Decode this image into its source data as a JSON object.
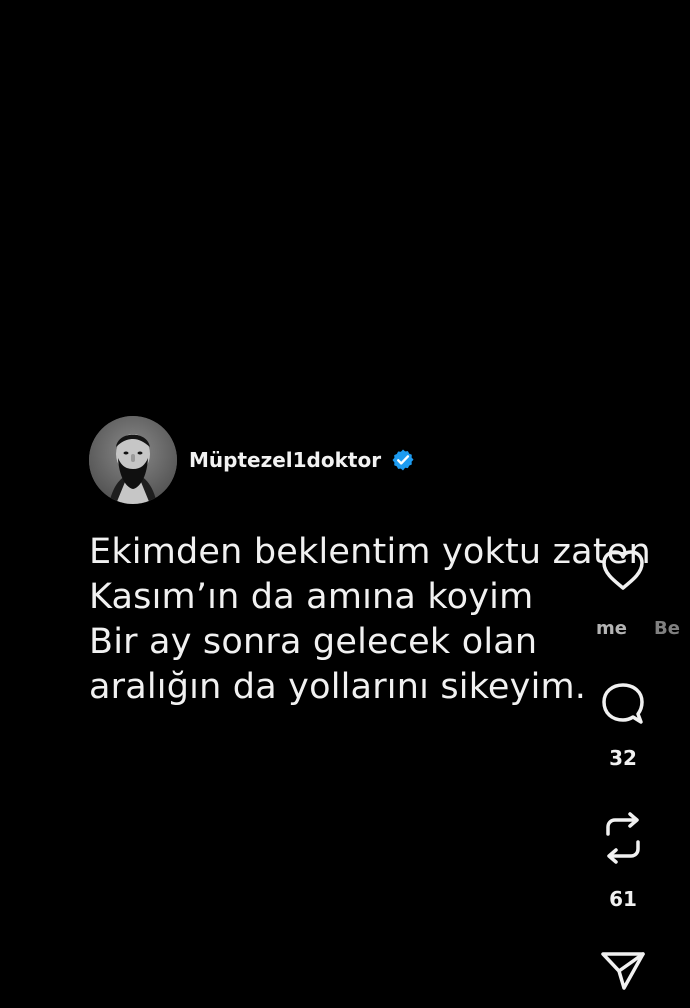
{
  "post": {
    "author": {
      "name": "Müptezel1doktor",
      "verified_icon": "verified-badge-icon",
      "avatar_icon": "bearded-man-avatar"
    },
    "quote_lines": [
      "Ekimden beklentim yoktu zaten",
      "Kasım’ın da amına koyim",
      "Bir ay sonra gelecek olan",
      "aralığın da yollarını sikeyim."
    ]
  },
  "actions": {
    "like_icon": "heart-icon",
    "comment_icon": "comment-icon",
    "comment_count": "32",
    "repost_icon": "repost-icon",
    "repost_count": "61",
    "share_icon": "send-icon"
  },
  "offscreen_labels": {
    "left": "me",
    "right": "Be"
  },
  "colors": {
    "background": "#000000",
    "text": "#f1f1f1",
    "verified": "#1d9bf0"
  }
}
